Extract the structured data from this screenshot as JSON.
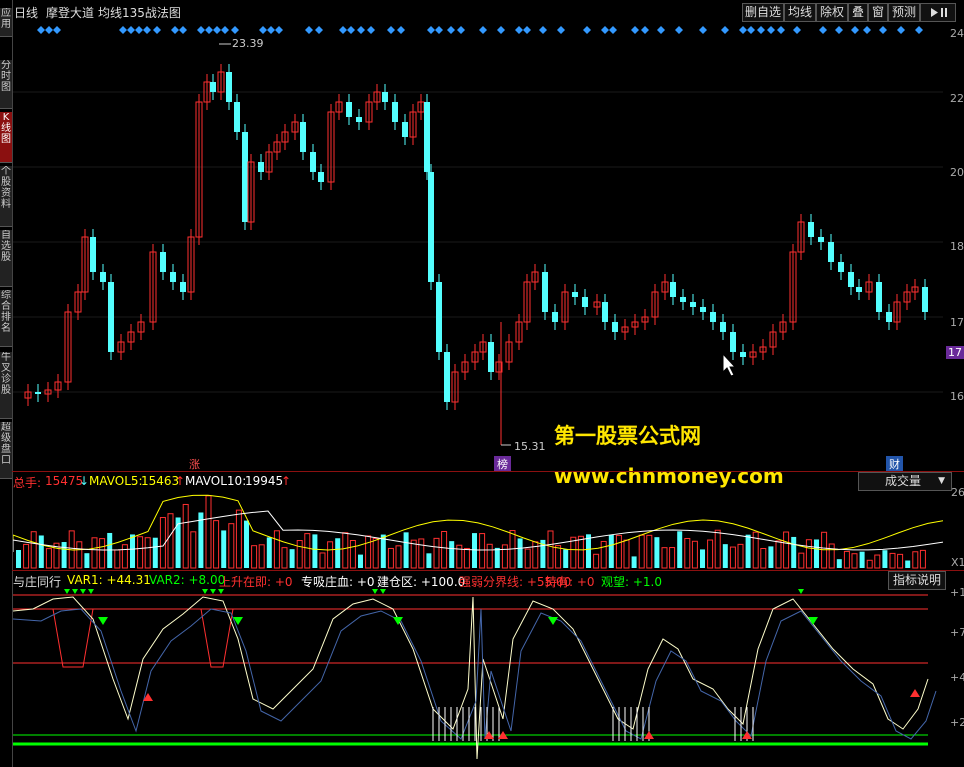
{
  "left_strip": [
    "应用",
    "分时图",
    "K线图",
    "个股资料",
    "自选股",
    "综合排名",
    "牛叉诊股",
    "超级盘口"
  ],
  "header": {
    "period": "日线",
    "stock_name": "摩登大道",
    "indicator_name": "均线135战法图",
    "buttons": [
      "删自选",
      "均线",
      "除权",
      "叠",
      "窗",
      "预测"
    ],
    "nav_icon": "play-pause-icon"
  },
  "price_axis": [
    "24",
    "22",
    "20",
    "18",
    "17",
    "17",
    "16"
  ],
  "price_labels": {
    "high": "23.39",
    "low": "15.31"
  },
  "event_tags": [
    {
      "label": "涨",
      "color": "#ff5050"
    },
    {
      "label": "榜",
      "color": "#cc66ff"
    },
    {
      "label": "财",
      "color": "#66aaff"
    }
  ],
  "watermark": {
    "line1": "第一股票公式网",
    "line2": "www.chnmoney.com"
  },
  "volume": {
    "label1": "总手:",
    "value1": "15475",
    "label2": "MAVOL5:",
    "value2": "15463",
    "label3": "MAVOL10:",
    "value3": "19945",
    "dropdown": "成交量",
    "axis": [
      "26",
      "X1"
    ]
  },
  "indicator": {
    "name": "与庄同行",
    "items": [
      {
        "label": "VAR1:",
        "value": "+44.31",
        "color": "#ffff00"
      },
      {
        "label": "VAR2:",
        "value": "+8.00",
        "color": "#00ff00"
      },
      {
        "label": "上升在即:",
        "value": "+0",
        "color": "#ff3030"
      },
      {
        "label": "专吸庄血:",
        "value": "+0",
        "color": "#ffffff"
      },
      {
        "label": "建仓区:",
        "value": "+100.0",
        "color": "#ffffff"
      },
      {
        "label": "强弱分界线:",
        "value": "+55.00",
        "color": "#ff3030"
      },
      {
        "label": "持有:",
        "value": "+0",
        "color": "#ff3030"
      },
      {
        "label": "观望:",
        "value": "+1.0",
        "color": "#00ff00"
      }
    ],
    "button": "指标说明",
    "axis": [
      "+1",
      "+7",
      "+4",
      "+2"
    ]
  },
  "colors": {
    "up": "#ff3030",
    "down": "#54ffff",
    "accent": "#8b1010",
    "marker": "#3399ff"
  }
}
